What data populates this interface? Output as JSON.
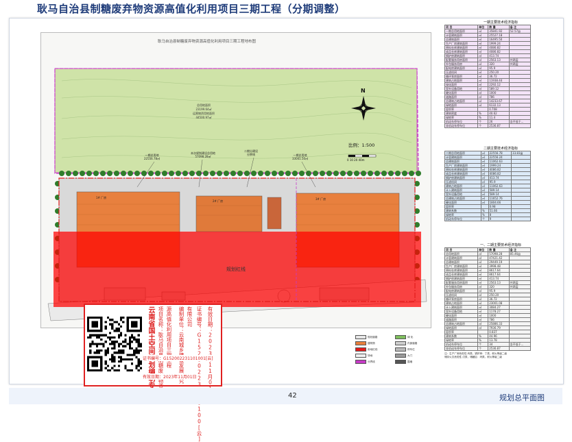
{
  "header": {
    "title": "耿马自治县制糖废弃物资源高值化利用项目三期工程（分期调整）"
  },
  "drawing": {
    "inner_title": "耿马自治县制糖废弃物资源高值化利用项目三期工程地布图",
    "land_labels": [
      "总用地面积",
      "23199.64㎡",
      "运营物资用地面积",
      "44500.97㎡"
    ],
    "phase_labels": [
      {
        "name": "一期总用地",
        "value": "22556.78㎡"
      },
      {
        "name": "本次规划建设总用地",
        "value": "57098.28㎡"
      },
      {
        "name": "二期分建设",
        "value": "分界线"
      },
      {
        "name": "一期总用地",
        "value": "33041.50㎡"
      }
    ],
    "scale": "比例：1:500",
    "scale_bar": "0  10  20   40m",
    "north": "N",
    "planning_label": "规划红线",
    "building_labels": [
      "1# 厂房",
      "2# 厂房",
      "3# 厂房"
    ]
  },
  "stamp": {
    "org": "云南省国土空间规划编制专用章",
    "lines": [
      "项目名称：耿马自治县制糖废弃物资",
      "源高值化利用项目三期工程",
      "编制单位：云南城乡建设发展研究",
      "有限公司",
      "证书编号：G15200223110100[云]",
      "有效日期：2023年11月01日"
    ],
    "cert_no": "证书编号：G152002231101001[云]",
    "date_label": "有效日期：2023年11月01日"
  },
  "table1": {
    "title": "一期主要技术经济指标",
    "headers": [
      "项 目",
      "单位",
      "数 量",
      "备 注"
    ],
    "rows": [
      [
        "一期总用地面积",
        "㎡",
        "35841.92",
        "52.57亩"
      ],
      [
        "计容建筑面积",
        "㎡",
        "25527.18",
        ""
      ],
      [
        "总建筑面积",
        "㎡",
        "16495.50",
        ""
      ],
      [
        "生产厂房建筑面积",
        "㎡",
        "1999.24",
        ""
      ],
      [
        "原料仓库建筑面积",
        "㎡",
        "4086.82",
        ""
      ],
      [
        "成品仓库建筑面积",
        "㎡",
        "4086.82",
        ""
      ],
      [
        "锅炉房建筑面积",
        "㎡",
        "413.74",
        ""
      ],
      [
        "配套服务用房面积",
        "㎡",
        "2563.13",
        "共两层"
      ],
      [
        "外包服务用房",
        "㎡",
        "320",
        "共两层"
      ],
      [
        "配电房建筑面积",
        "㎡",
        "95.9",
        ""
      ],
      [
        "压滤机间",
        "㎡",
        "250.20",
        ""
      ],
      [
        "循环泵房面积",
        "㎡",
        "36.72",
        ""
      ],
      [
        "建筑占地面积",
        "㎡",
        "11938.44",
        ""
      ],
      [
        "绿化面积",
        "㎡",
        "2292.12",
        ""
      ],
      [
        "室外设备用地",
        "㎡",
        "589.12",
        ""
      ],
      [
        "硬化面积",
        "㎡",
        "1000",
        ""
      ],
      [
        "道路面积",
        "㎡",
        "786",
        ""
      ],
      [
        "总建筑占地面积",
        "㎡",
        "14233.67",
        ""
      ],
      [
        "绿地面积",
        "㎡",
        "6132.13",
        ""
      ],
      [
        "容积率",
        "",
        "0.708",
        ""
      ],
      [
        "建筑密度",
        "%",
        "40.62",
        ""
      ],
      [
        "绿地率",
        "%",
        "11.4",
        ""
      ],
      [
        "机动车停车位",
        "个",
        "26",
        "含不低于..."
      ],
      [
        "非机动车停车位",
        "个",
        "2536.87",
        ""
      ]
    ]
  },
  "table2": {
    "title": "二期主要技术经济指标",
    "rows": [
      [
        "二期总用地面积",
        "㎡",
        "22556.78",
        "33.83亩"
      ],
      [
        "计容建筑面积",
        "㎡",
        "22556.24",
        ""
      ],
      [
        "总建筑面积",
        "㎡",
        "11062.63",
        ""
      ],
      [
        "生产厂房建筑面积",
        "㎡",
        "1999.24",
        ""
      ],
      [
        "原料仓库建筑面积",
        "㎡",
        "4086.82",
        ""
      ],
      [
        "成品仓库建筑面积",
        "㎡",
        "4086.82",
        ""
      ],
      [
        "锅炉房建筑面积",
        "㎡",
        "413.74",
        ""
      ],
      [
        "压滤机间",
        "㎡",
        "95.9",
        ""
      ],
      [
        "建筑占地面积",
        "㎡",
        "11062.63",
        ""
      ],
      [
        "计入建筑面积",
        "㎡",
        "589.14",
        ""
      ],
      [
        "室外设备用地",
        "㎡",
        "589.14",
        ""
      ],
      [
        "总建筑占地面积",
        "㎡",
        "11652.76",
        ""
      ],
      [
        "硬化面积",
        "㎡",
        "1804.66",
        ""
      ],
      [
        "容积率",
        "",
        "0.98",
        ""
      ],
      [
        "建筑系数",
        "%",
        "51.66",
        ""
      ],
      [
        "绿地率",
        "%",
        "8",
        ""
      ],
      [
        "机动车停车位",
        "个",
        "9",
        ""
      ]
    ]
  },
  "table3": {
    "title": "一、二期主要技术经济指标",
    "headers": [
      "项 目",
      "单位",
      "数 量",
      "备 注"
    ],
    "rows": [
      [
        "总用地面积",
        "㎡",
        "57098.28",
        "85.46亩"
      ],
      [
        "计容建筑面积",
        "㎡",
        "47421.42",
        ""
      ],
      [
        "总建筑面积",
        "㎡",
        "29449.19",
        ""
      ],
      [
        "生产厂房建筑面积",
        "㎡",
        "3998.48",
        ""
      ],
      [
        "原料仓库建筑面积",
        "㎡",
        "8617.64",
        ""
      ],
      [
        "成品仓库建筑面积",
        "㎡",
        "8617.64",
        ""
      ],
      [
        "锅炉房建筑面积",
        "㎡",
        "413.74",
        ""
      ],
      [
        "配套服务用房面积",
        "㎡",
        "2563.13",
        "共两层"
      ],
      [
        "外包服务用房",
        "㎡",
        "320",
        "共两层"
      ],
      [
        "配电房建筑面积",
        "㎡",
        "95.9",
        ""
      ],
      [
        "压滤机间",
        "㎡",
        "250.20",
        ""
      ],
      [
        "循环泵房面积",
        "㎡",
        "36.72",
        ""
      ],
      [
        "建筑占地面积",
        "㎡",
        "23001.08",
        ""
      ],
      [
        "计入建筑面积",
        "㎡",
        "3084.27",
        ""
      ],
      [
        "室外设备用地",
        "㎡",
        "1178.27",
        ""
      ],
      [
        "硬化面积",
        "㎡",
        "1000",
        ""
      ],
      [
        "道路面积",
        "㎡",
        "786",
        ""
      ],
      [
        "总建筑占地面积",
        "㎡",
        "25886.33",
        ""
      ],
      [
        "绿地面积",
        "㎡",
        "7936.79",
        ""
      ],
      [
        "容积率",
        "",
        "0.837",
        ""
      ],
      [
        "建筑系数",
        "%",
        "44.96",
        ""
      ],
      [
        "绿地率",
        "%",
        "13.78",
        ""
      ],
      [
        "机动车停车位",
        "个",
        "34",
        "含不低于..."
      ],
      [
        "非机动车停车位",
        "个",
        "2536.87",
        ""
      ]
    ],
    "notes": [
      "注：生产厂房危险性 丙类，锅炉房：丁类，耐火等级二级",
      "储存火灾危险性 戊类，储藏区：丙类，耐火等级二级"
    ]
  },
  "legend": {
    "items": [
      "规划道路",
      "绿 化",
      "建筑物",
      "内部道路",
      "用地红线",
      "停车位",
      "场地",
      "大门",
      "分界线",
      "围墙"
    ]
  },
  "footer": {
    "page_number": "42",
    "caption": "规划总平面图"
  }
}
